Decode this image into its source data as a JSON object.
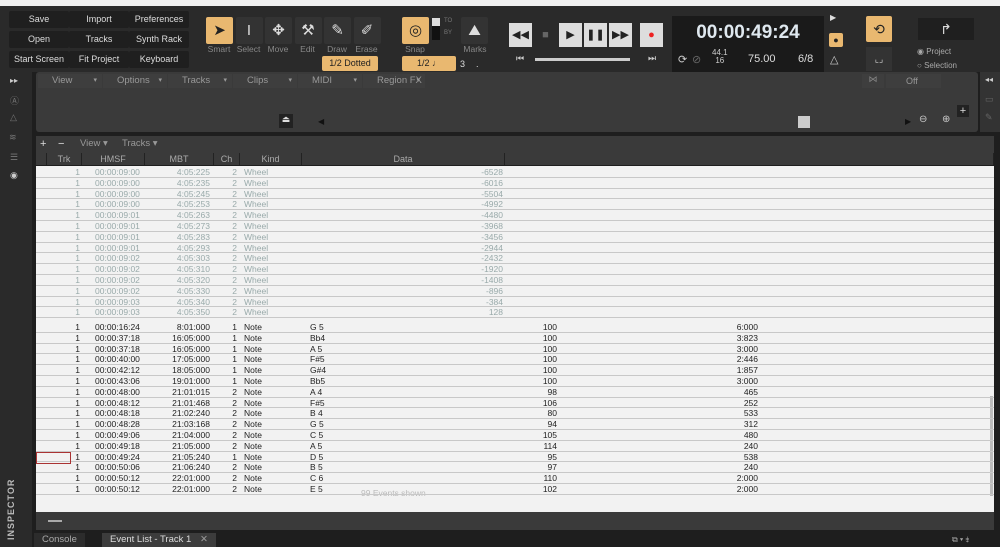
{
  "toolbar": {
    "quick_buttons": [
      "Save",
      "Import",
      "Preferences",
      "Open",
      "Tracks",
      "Synth Rack",
      "Start Screen",
      "Fit Project",
      "Keyboard"
    ],
    "tools": [
      {
        "label": "Smart",
        "icon": "arrow-pointer-icon",
        "active": true
      },
      {
        "label": "Select",
        "icon": "i-beam-icon"
      },
      {
        "label": "Move",
        "icon": "move-arrows-icon"
      },
      {
        "label": "Edit",
        "icon": "wrench-icon"
      },
      {
        "label": "Draw",
        "icon": "pencil-icon"
      },
      {
        "label": "Erase",
        "icon": "eraser-icon"
      }
    ],
    "snap_duration": "1/2 Dotted",
    "snap_label": "Snap",
    "marks_label": "Marks",
    "to_label": "TO",
    "by_label": "BY",
    "snap_value": "1/2",
    "snap_triplet": "3",
    "snap_dot": ".",
    "time": "00:00:49:24",
    "sample_rate": "44.1",
    "bit_depth": "16",
    "tempo": "75.00",
    "meter": "6/8",
    "radio_project": "Project",
    "radio_selection": "Selection",
    "selected_radio": "Project",
    "accent": "#e9b870"
  },
  "track_view": {
    "menus": [
      "View",
      "Options",
      "Tracks",
      "Clips",
      "MIDI",
      "Region FX"
    ],
    "snap_off": "Off"
  },
  "event_list": {
    "toolbar": {
      "add": "+",
      "remove": "−",
      "menus": [
        "View",
        "Tracks"
      ]
    },
    "columns": [
      "Trk",
      "HMSF",
      "MBT",
      "Ch",
      "Kind",
      "Data"
    ],
    "rows": [
      [
        "1",
        "00:00:09:00",
        "4:05:225",
        "2",
        "Wheel",
        "-6528",
        "",
        ""
      ],
      [
        "1",
        "00:00:09:00",
        "4:05:235",
        "2",
        "Wheel",
        "-6016",
        "",
        ""
      ],
      [
        "1",
        "00:00:09:00",
        "4:05:245",
        "2",
        "Wheel",
        "-5504",
        "",
        ""
      ],
      [
        "1",
        "00:00:09:00",
        "4:05:253",
        "2",
        "Wheel",
        "-4992",
        "",
        ""
      ],
      [
        "1",
        "00:00:09:01",
        "4:05:263",
        "2",
        "Wheel",
        "-4480",
        "",
        ""
      ],
      [
        "1",
        "00:00:09:01",
        "4:05:273",
        "2",
        "Wheel",
        "-3968",
        "",
        ""
      ],
      [
        "1",
        "00:00:09:01",
        "4:05:283",
        "2",
        "Wheel",
        "-3456",
        "",
        ""
      ],
      [
        "1",
        "00:00:09:01",
        "4:05:293",
        "2",
        "Wheel",
        "-2944",
        "",
        ""
      ],
      [
        "1",
        "00:00:09:02",
        "4:05:303",
        "2",
        "Wheel",
        "-2432",
        "",
        ""
      ],
      [
        "1",
        "00:00:09:02",
        "4:05:310",
        "2",
        "Wheel",
        "-1920",
        "",
        ""
      ],
      [
        "1",
        "00:00:09:02",
        "4:05:320",
        "2",
        "Wheel",
        "-1408",
        "",
        ""
      ],
      [
        "1",
        "00:00:09:02",
        "4:05:330",
        "2",
        "Wheel",
        "-896",
        "",
        ""
      ],
      [
        "1",
        "00:00:09:03",
        "4:05:340",
        "2",
        "Wheel",
        "-384",
        "",
        ""
      ],
      [
        "1",
        "00:00:09:03",
        "4:05:350",
        "2",
        "Wheel",
        "128",
        "",
        ""
      ],
      [
        "1",
        "00:00:16:24",
        "8:01:000",
        "1",
        "Note",
        "G 5",
        "100",
        "6:000"
      ],
      [
        "1",
        "00:00:37:18",
        "16:05:000",
        "1",
        "Note",
        "Bb4",
        "100",
        "3:823"
      ],
      [
        "1",
        "00:00:37:18",
        "16:05:000",
        "1",
        "Note",
        "A 5",
        "100",
        "3:000"
      ],
      [
        "1",
        "00:00:40:00",
        "17:05:000",
        "1",
        "Note",
        "F#5",
        "100",
        "2:446"
      ],
      [
        "1",
        "00:00:42:12",
        "18:05:000",
        "1",
        "Note",
        "G#4",
        "100",
        "1:857"
      ],
      [
        "1",
        "00:00:43:06",
        "19:01:000",
        "1",
        "Note",
        "Bb5",
        "100",
        "3:000"
      ],
      [
        "1",
        "00:00:48:00",
        "21:01:015",
        "2",
        "Note",
        "A 4",
        "98",
        "465"
      ],
      [
        "1",
        "00:00:48:12",
        "21:01:468",
        "2",
        "Note",
        "F#5",
        "106",
        "252"
      ],
      [
        "1",
        "00:00:48:18",
        "21:02:240",
        "2",
        "Note",
        "B 4",
        "80",
        "533"
      ],
      [
        "1",
        "00:00:48:28",
        "21:03:168",
        "2",
        "Note",
        "G 5",
        "94",
        "312"
      ],
      [
        "1",
        "00:00:49:06",
        "21:04:000",
        "2",
        "Note",
        "C 5",
        "105",
        "480"
      ],
      [
        "1",
        "00:00:49:18",
        "21:05:000",
        "2",
        "Note",
        "A 5",
        "114",
        "240"
      ],
      [
        "1",
        "00:00:49:24",
        "21:05:240",
        "1",
        "Note",
        "D 5",
        "95",
        "538"
      ],
      [
        "1",
        "00:00:50:06",
        "21:06:240",
        "2",
        "Note",
        "B 5",
        "97",
        "240"
      ],
      [
        "1",
        "00:00:50:12",
        "22:01:000",
        "2",
        "Note",
        "C 6",
        "110",
        "2:000"
      ],
      [
        "1",
        "00:00:50:12",
        "22:01:000",
        "2",
        "Note",
        "E 5",
        "102",
        "2:000"
      ]
    ],
    "focused_row": 26,
    "status": "99 Events shown"
  },
  "bottom": {
    "tabs": [
      "Console",
      "Event List - Track 1"
    ],
    "close": "✕",
    "inspector": "INSPECTOR"
  }
}
